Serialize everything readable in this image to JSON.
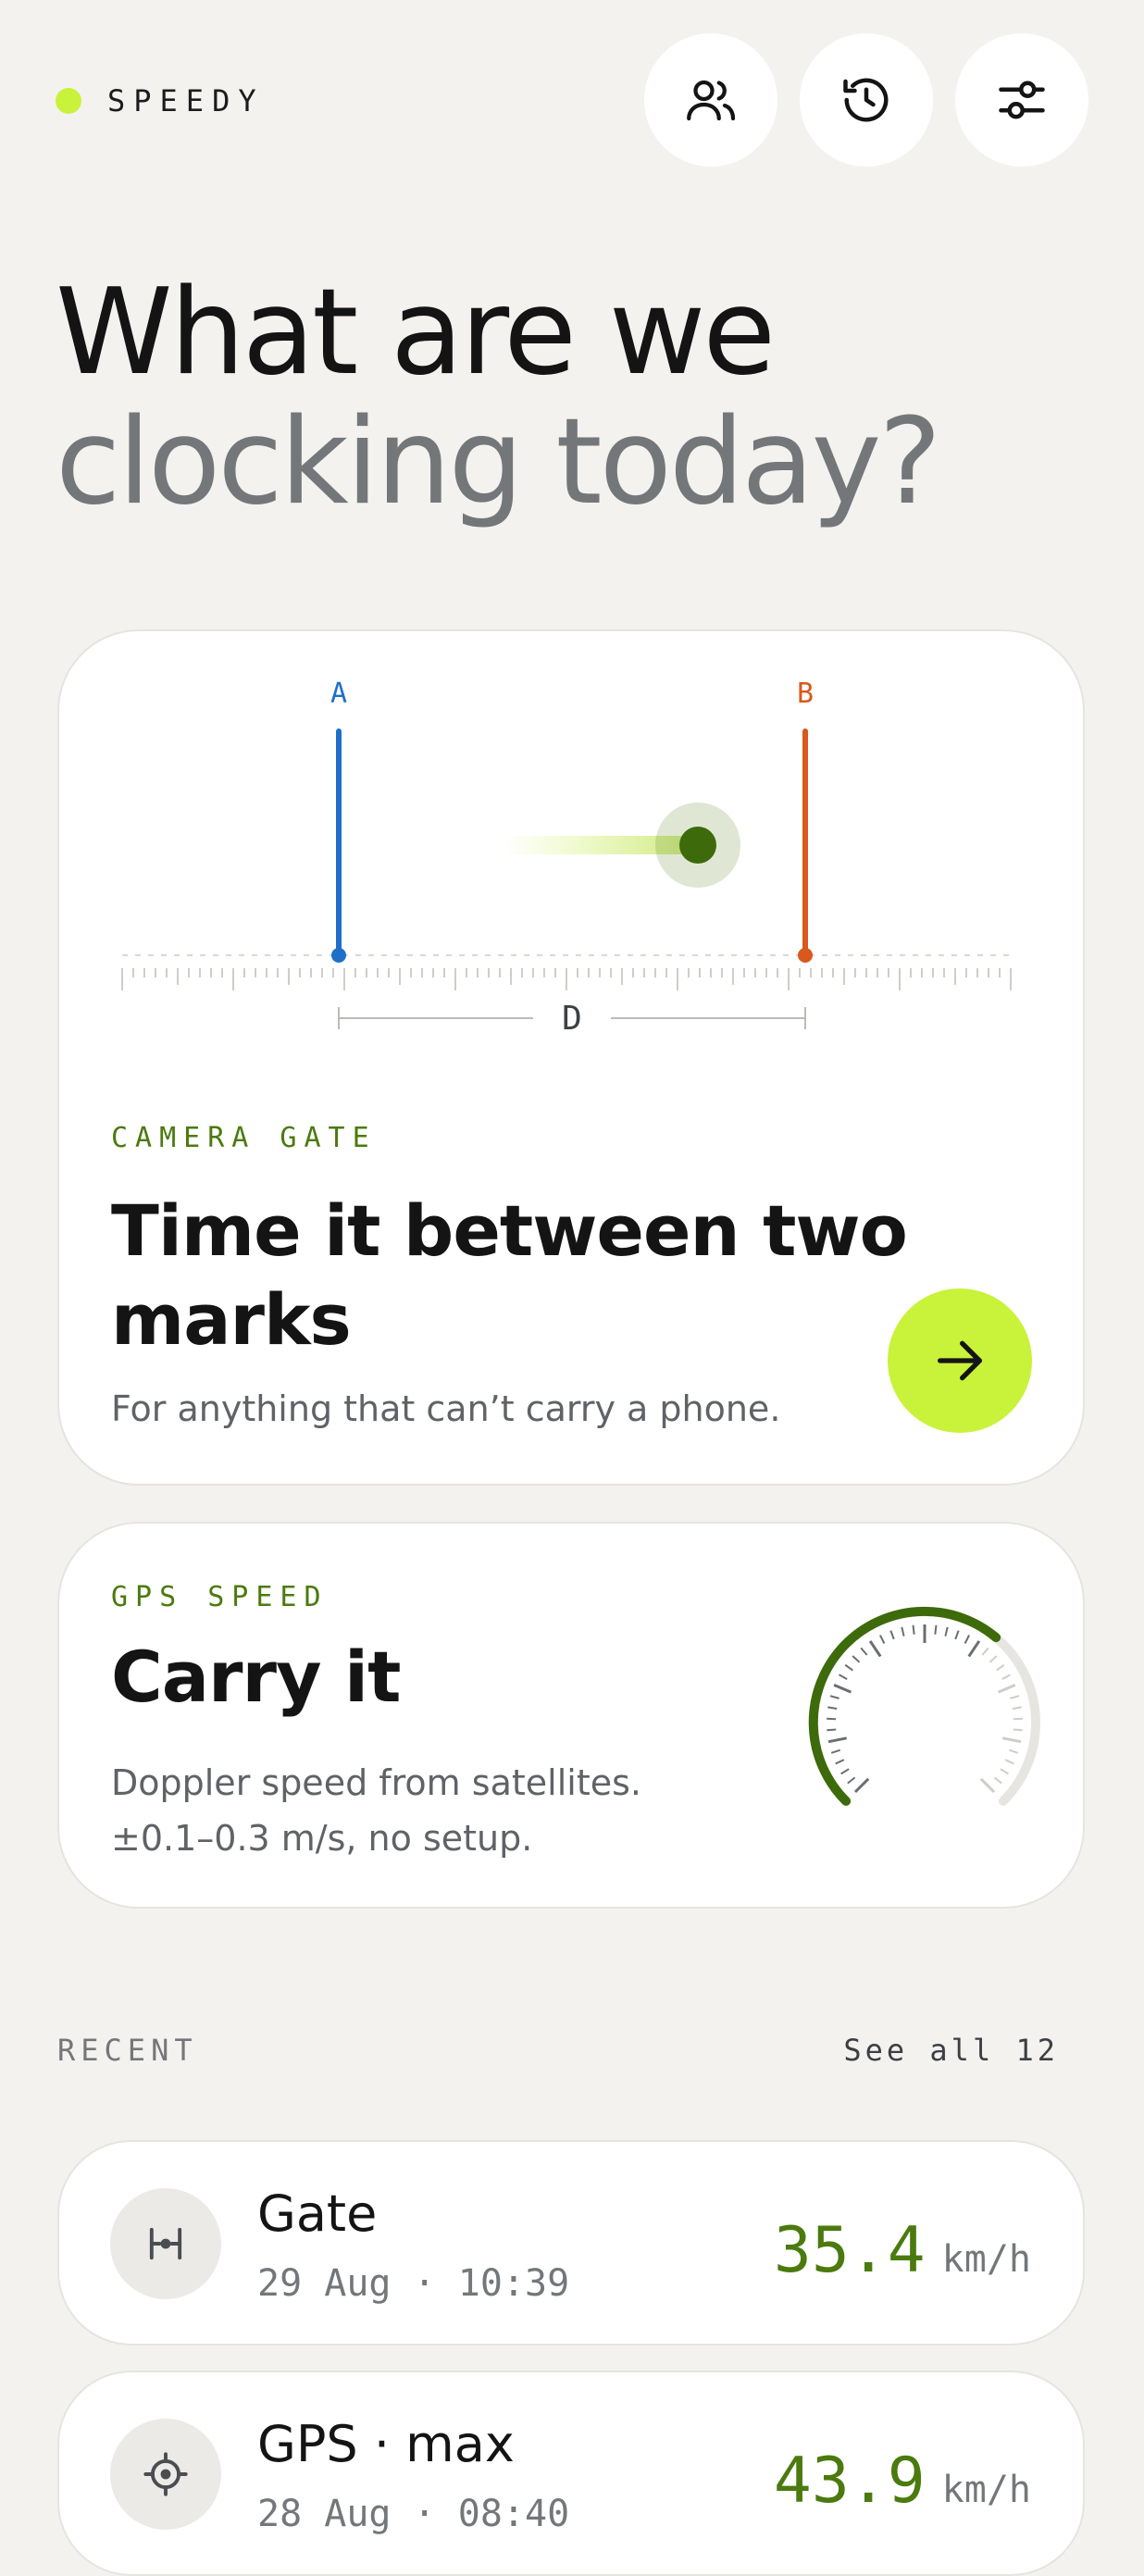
{
  "app": {
    "name": "SPEEDY",
    "accent": "#c9f23a",
    "brand_green": "#4b7a0e"
  },
  "header": {
    "buttons": [
      {
        "icon": "users-icon"
      },
      {
        "icon": "history-icon"
      },
      {
        "icon": "sliders-icon"
      }
    ]
  },
  "hero": {
    "line1": "What are we",
    "line2": "clocking today?"
  },
  "gate_card": {
    "diagram": {
      "mark_a": "A",
      "mark_b": "B",
      "distance": "D",
      "color_a": "#1f6fc9",
      "color_b": "#d9581c"
    },
    "eyebrow": "CAMERA GATE",
    "title_line1": "Time it between two",
    "title_line2": "marks",
    "subtitle": "For anything that can’t carry a phone.",
    "action_icon": "arrow-right-icon"
  },
  "gps_card": {
    "eyebrow": "GPS SPEED",
    "title": "Carry it",
    "subtitle_line1": "Doppler speed from satellites.",
    "subtitle_line2": "±0.1–0.3 m/s, no setup."
  },
  "recent": {
    "label": "RECENT",
    "see_all": "See all 12",
    "items": [
      {
        "icon": "gate-icon",
        "title": "Gate",
        "meta": "29 Aug · 10:39",
        "value": "35.4",
        "unit": "km/h"
      },
      {
        "icon": "crosshair-icon",
        "title": "GPS · max",
        "meta": "28 Aug · 08:40",
        "value": "43.9",
        "unit": "km/h"
      }
    ]
  }
}
